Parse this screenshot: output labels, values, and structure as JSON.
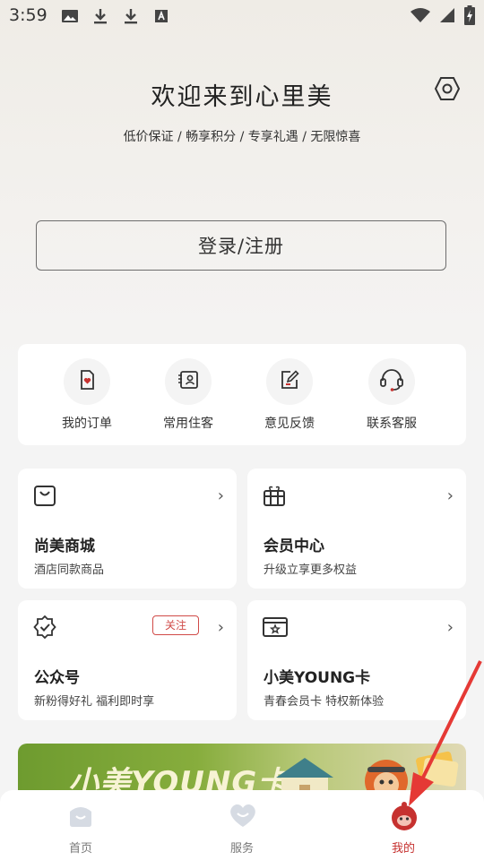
{
  "status_bar": {
    "time": "3:59"
  },
  "header": {
    "title": "欢迎来到心里美",
    "subtitle": "低价保证 / 畅享积分 / 专享礼遇 / 无限惊喜"
  },
  "login": {
    "label": "登录/注册"
  },
  "quick_actions": [
    {
      "label": "我的订单",
      "icon": "order-icon"
    },
    {
      "label": "常用住客",
      "icon": "guest-card-icon"
    },
    {
      "label": "意见反馈",
      "icon": "feedback-edit-icon"
    },
    {
      "label": "联系客服",
      "icon": "headset-icon"
    }
  ],
  "tiles": [
    {
      "title": "尚美商城",
      "desc": "酒店同款商品",
      "icon": "shopping-bag-icon"
    },
    {
      "title": "会员中心",
      "desc": "升级立享更多权益",
      "icon": "gift-icon"
    },
    {
      "title": "公众号",
      "desc": "新粉得好礼  福利即时享",
      "icon": "verified-badge-icon",
      "badge": "关注"
    },
    {
      "title": "小美YOUNG卡",
      "desc": "青春会员卡  特权新体验",
      "icon": "member-card-icon"
    }
  ],
  "banner": {
    "text": "小美YOUNG卡"
  },
  "tabbar": [
    {
      "label": "首页",
      "icon": "home-icon",
      "active": false
    },
    {
      "label": "服务",
      "icon": "heart-service-icon",
      "active": false
    },
    {
      "label": "我的",
      "icon": "mascot-profile-icon",
      "active": true
    }
  ],
  "colors": {
    "accent": "#c6312f",
    "badge": "#d04a47",
    "annotation_arrow": "#e53935"
  }
}
